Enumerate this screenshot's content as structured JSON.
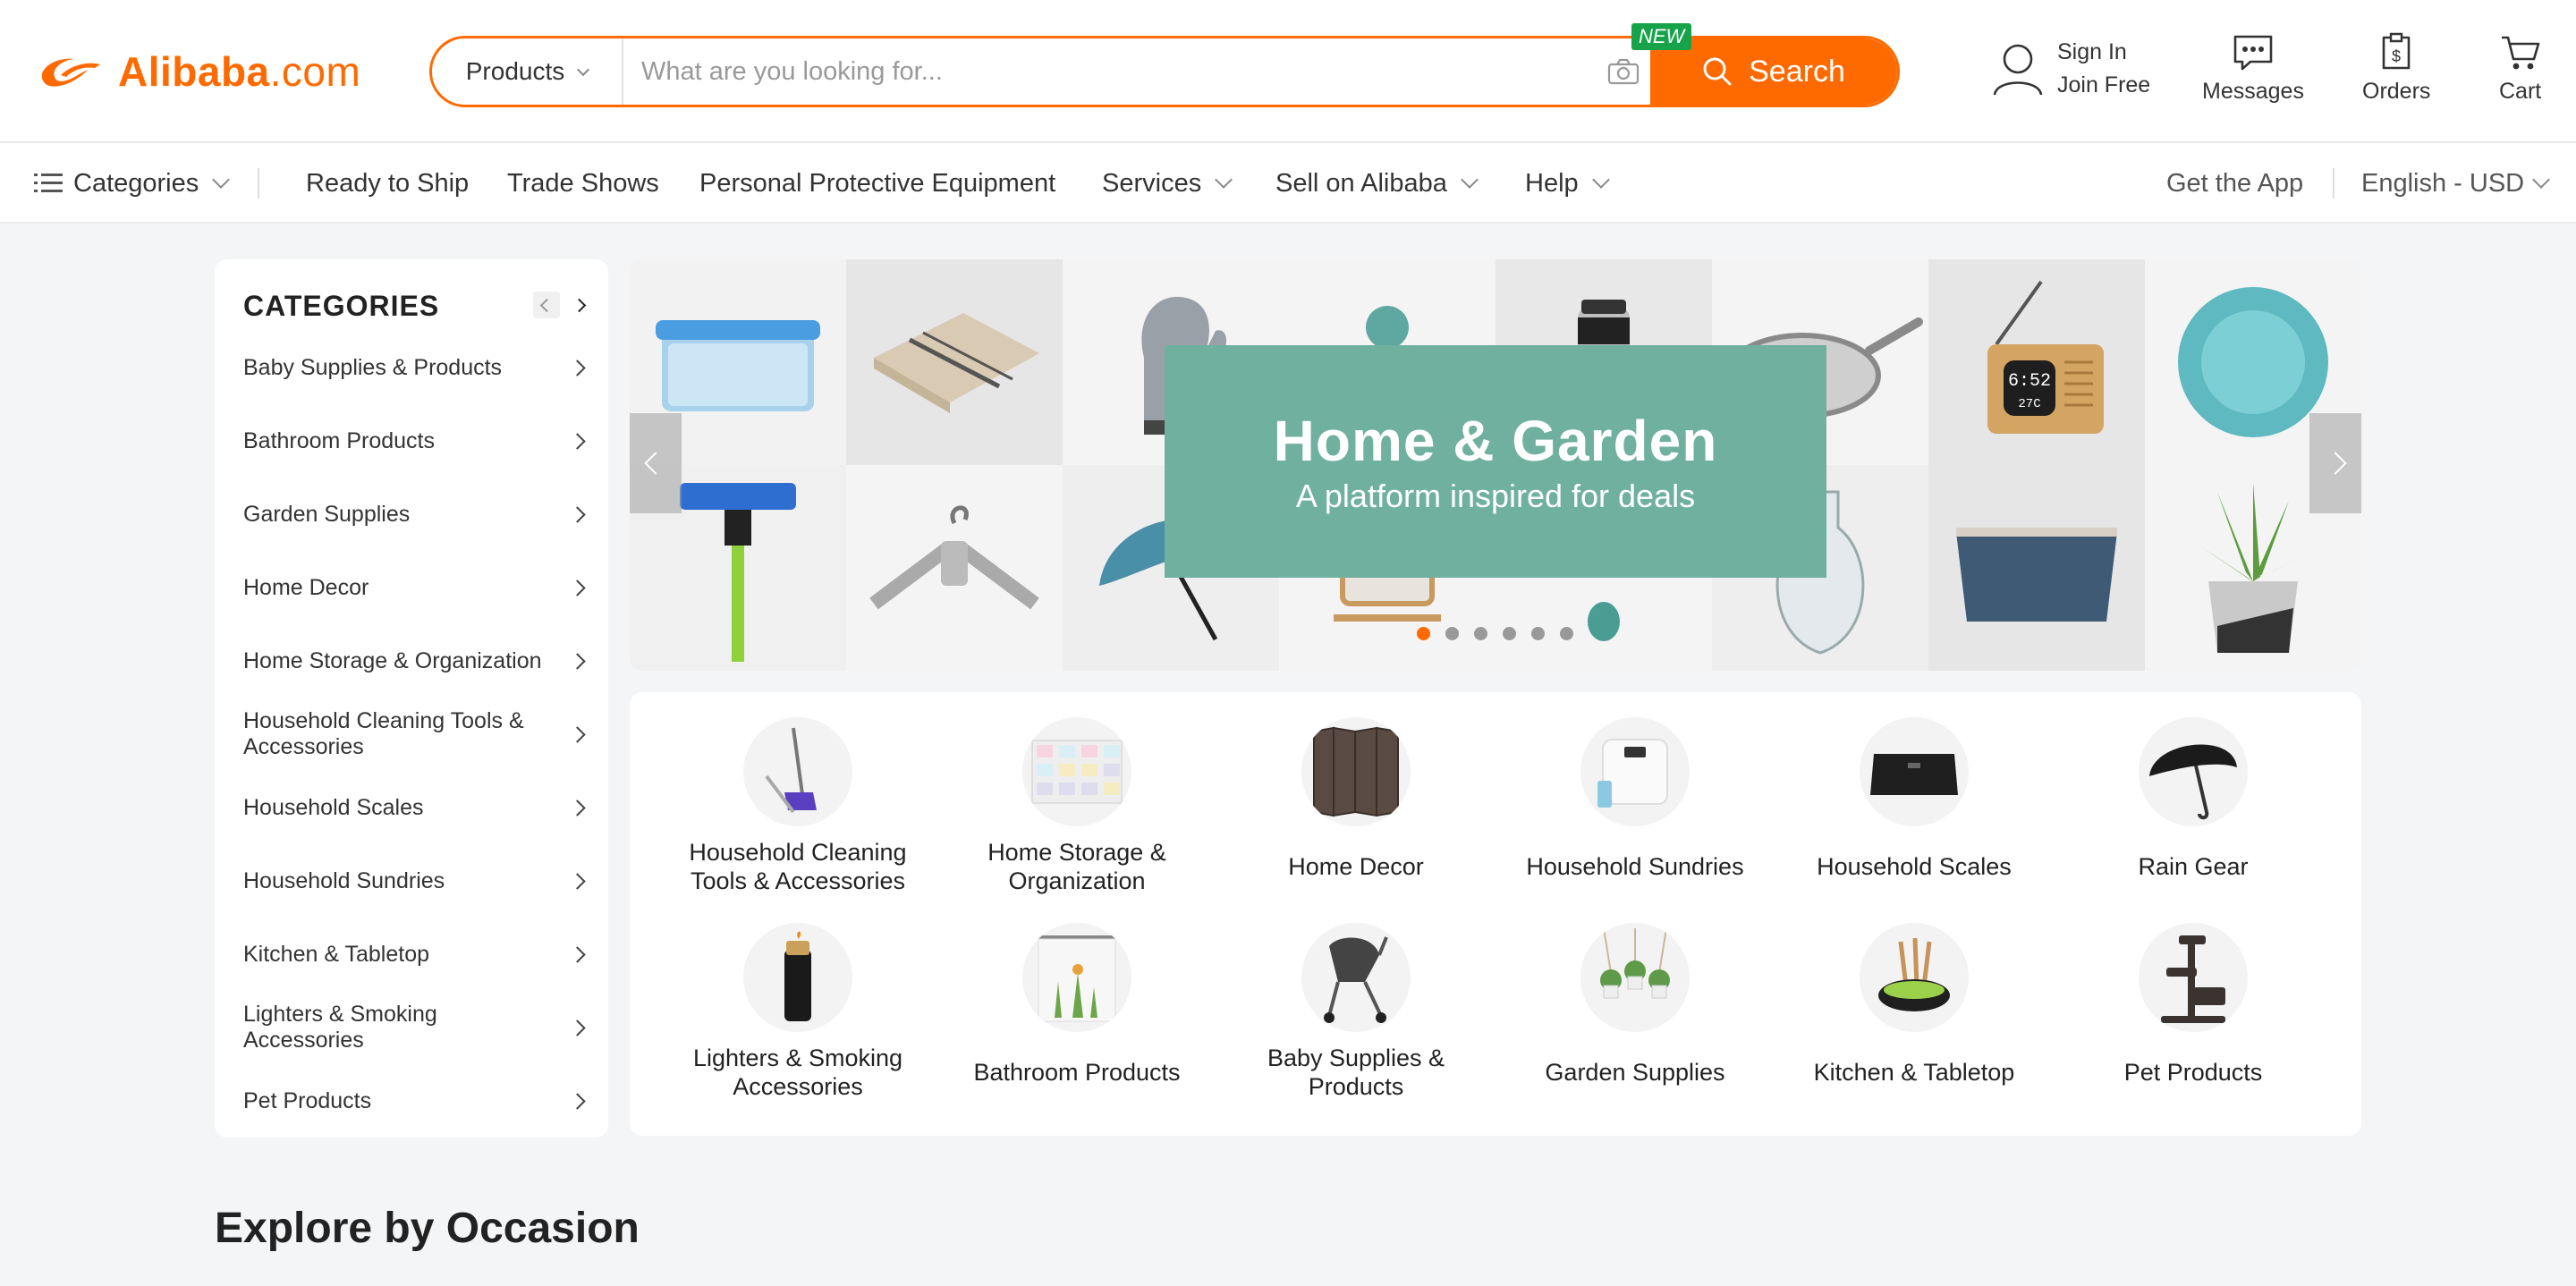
{
  "header": {
    "logo_text": "Alibaba",
    "logo_suffix": ".com",
    "search_category": "Products",
    "search_placeholder": "What are you looking for...",
    "new_badge": "NEW",
    "search_button": "Search",
    "sign_in": "Sign In",
    "join_free": "Join Free",
    "messages": "Messages",
    "orders": "Orders",
    "cart": "Cart",
    "brand_color": "#ff6a00"
  },
  "nav": {
    "categories": "Categories",
    "ready_to_ship": "Ready to Ship",
    "trade_shows": "Trade Shows",
    "ppe": "Personal Protective Equipment",
    "services": "Services",
    "sell": "Sell on Alibaba",
    "help": "Help",
    "get_app": "Get the App",
    "locale": "English - USD"
  },
  "sidebar": {
    "title": "CATEGORIES",
    "items": [
      "Baby Supplies & Products",
      "Bathroom Products",
      "Garden Supplies",
      "Home Decor",
      "Home Storage & Organization",
      "Household Cleaning Tools & Accessories",
      "Household Scales",
      "Household Sundries",
      "Kitchen & Tabletop",
      "Lighters & Smoking Accessories",
      "Pet Products"
    ]
  },
  "banner": {
    "title": "Home & Garden",
    "subtitle": "A platform inspired for deals",
    "slide_count": 6,
    "active_slide": 1,
    "accent": "#6fb09f"
  },
  "grid": {
    "items": [
      {
        "label": "Household Cleaning Tools & Accessories",
        "icon": "broom-icon"
      },
      {
        "label": "Home Storage & Organization",
        "icon": "storage-drawers-icon"
      },
      {
        "label": "Home Decor",
        "icon": "folding-screen-icon"
      },
      {
        "label": "Household Sundries",
        "icon": "bathroom-scale-icon"
      },
      {
        "label": "Household Scales",
        "icon": "digital-scale-icon"
      },
      {
        "label": "Rain Gear",
        "icon": "umbrella-icon"
      },
      {
        "label": "Lighters & Smoking Accessories",
        "icon": "lighter-icon"
      },
      {
        "label": "Bathroom Products",
        "icon": "shower-curtain-icon"
      },
      {
        "label": "Baby Supplies & Products",
        "icon": "stroller-icon"
      },
      {
        "label": "Garden Supplies",
        "icon": "hanging-planter-icon"
      },
      {
        "label": "Kitchen & Tabletop",
        "icon": "cookware-icon"
      },
      {
        "label": "Pet Products",
        "icon": "cat-tree-icon"
      }
    ]
  },
  "section": {
    "title": "Explore by Occasion"
  }
}
